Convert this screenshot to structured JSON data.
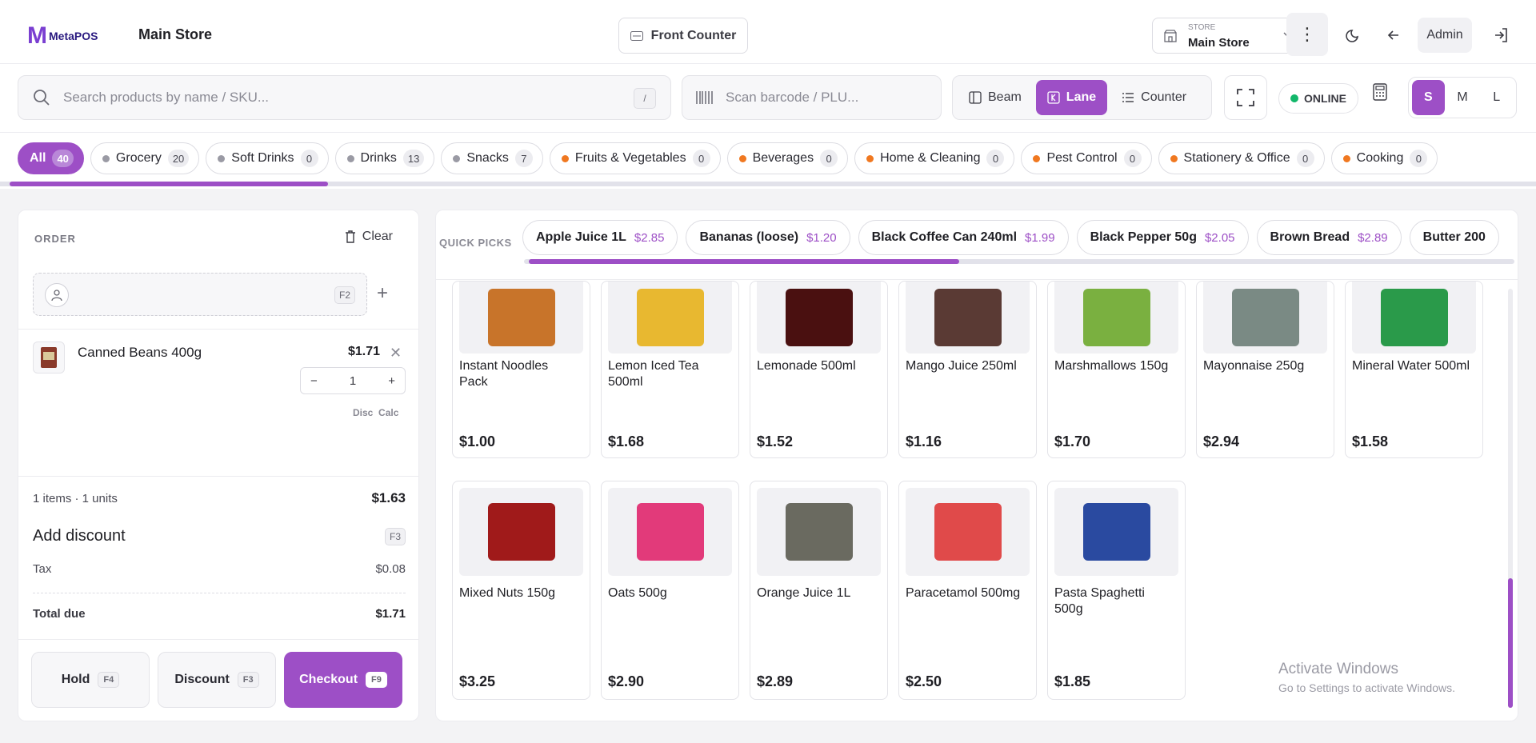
{
  "header": {
    "logo_text": "MetaPOS",
    "store_title": "Main Store",
    "front_counter_label": "Front Counter",
    "store_select_label": "STORE",
    "store_select_value": "Main Store",
    "admin_label": "Admin"
  },
  "search": {
    "placeholder": "Search products by name / SKU...",
    "shortcut": "/",
    "scan_placeholder": "Scan barcode / PLU..."
  },
  "modes": [
    {
      "label": "Beam",
      "active": false
    },
    {
      "label": "Lane",
      "active": true
    },
    {
      "label": "Counter",
      "active": false
    }
  ],
  "status": {
    "online_label": "ONLINE",
    "color": "#12b76a"
  },
  "sizes": [
    {
      "label": "S",
      "active": true
    },
    {
      "label": "M",
      "active": false
    },
    {
      "label": "L",
      "active": false
    }
  ],
  "categories": [
    {
      "label": "All",
      "count": "40",
      "active": true,
      "dot": "none"
    },
    {
      "label": "Grocery",
      "count": "20",
      "dot": "gray"
    },
    {
      "label": "Soft Drinks",
      "count": "0",
      "dot": "gray"
    },
    {
      "label": "Drinks",
      "count": "13",
      "dot": "gray"
    },
    {
      "label": "Snacks",
      "count": "7",
      "dot": "gray"
    },
    {
      "label": "Fruits & Vegetables",
      "count": "0",
      "dot": "orange"
    },
    {
      "label": "Beverages",
      "count": "0",
      "dot": "orange"
    },
    {
      "label": "Home & Cleaning",
      "count": "0",
      "dot": "orange"
    },
    {
      "label": "Pest Control",
      "count": "0",
      "dot": "orange"
    },
    {
      "label": "Stationery & Office",
      "count": "0",
      "dot": "orange"
    },
    {
      "label": "Cooking",
      "count": "0",
      "dot": "orange"
    }
  ],
  "order": {
    "heading": "ORDER",
    "clear_label": "Clear",
    "customer_shortcut": "F2",
    "items": [
      {
        "name": "Canned Beans 400g",
        "price": "$1.71",
        "qty": "1"
      }
    ],
    "disc_label": "Disc",
    "calc_label": "Calc",
    "summary_count": "1 items · 1 units",
    "summary_amount": "$1.63",
    "add_discount_label": "Add discount",
    "add_discount_shortcut": "F3",
    "tax_label": "Tax",
    "tax_value": "$0.08",
    "total_label": "Total due",
    "total_value": "$1.71",
    "buttons": {
      "hold": "Hold",
      "hold_key": "F4",
      "discount": "Discount",
      "discount_key": "F3",
      "checkout": "Checkout",
      "checkout_key": "F9"
    }
  },
  "quick_picks": {
    "label": "QUICK PICKS",
    "items": [
      {
        "name": "Apple Juice 1L",
        "price": "$2.85"
      },
      {
        "name": "Bananas (loose)",
        "price": "$1.20"
      },
      {
        "name": "Black Coffee Can 240ml",
        "price": "$1.99"
      },
      {
        "name": "Black Pepper 50g",
        "price": "$2.05"
      },
      {
        "name": "Brown Bread",
        "price": "$2.89"
      },
      {
        "name": "Butter 200",
        "price": ""
      }
    ]
  },
  "products": [
    {
      "name": "Instant Noodles Pack",
      "price": "$1.00",
      "color": "#c8742a"
    },
    {
      "name": "Lemon Iced Tea 500ml",
      "price": "$1.68",
      "color": "#e8b830"
    },
    {
      "name": "Lemonade 500ml",
      "price": "$1.52",
      "color": "#4a1010"
    },
    {
      "name": "Mango Juice 250ml",
      "price": "$1.16",
      "color": "#5a3a34"
    },
    {
      "name": "Marshmallows 150g",
      "price": "$1.70",
      "color": "#7ab040"
    },
    {
      "name": "Mayonnaise 250g",
      "price": "$2.94",
      "color": "#7a8a84"
    },
    {
      "name": "Mineral Water 500ml",
      "price": "$1.58",
      "color": "#2a9a4a"
    },
    {
      "name": "Mixed Nuts 150g",
      "price": "$3.25",
      "color": "#a01a1a"
    },
    {
      "name": "Oats 500g",
      "price": "$2.90",
      "color": "#e23a7a"
    },
    {
      "name": "Orange Juice 1L",
      "price": "$2.89",
      "color": "#6a6a60"
    },
    {
      "name": "Paracetamol 500mg",
      "price": "$2.50",
      "color": "#e04a4a"
    },
    {
      "name": "Pasta Spaghetti 500g",
      "price": "$1.85",
      "color": "#2a4aa0"
    }
  ],
  "watermark": {
    "line1": "Activate Windows",
    "line2": "Go to Settings to activate Windows."
  },
  "colors": {
    "accent": "#9d4fc6",
    "online": "#12b76a",
    "orange_dot": "#f07820"
  }
}
